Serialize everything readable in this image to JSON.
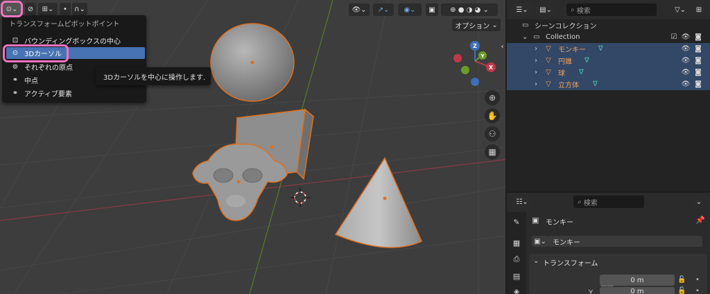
{
  "viewport": {
    "options_label": "オプション",
    "axis_labels": {
      "x": "X",
      "y": "Y",
      "z": "Z"
    }
  },
  "pivot_menu": {
    "title": "トランスフォームピボットポイント",
    "items": [
      {
        "label": "バウンディングボックスの中心",
        "icon": "bounding-box-icon"
      },
      {
        "label": "3Dカーソル",
        "icon": "cursor-icon",
        "active": true
      },
      {
        "label": "それぞれの原点",
        "icon": "individual-origins-icon"
      },
      {
        "label": "中点",
        "icon": "median-point-icon"
      },
      {
        "label": "アクティブ要素",
        "icon": "active-element-icon"
      }
    ],
    "tooltip": "3Dカーソルを中心に操作します."
  },
  "outliner": {
    "search_placeholder": "検索",
    "scene_collection": "シーンコレクション",
    "collection": "Collection",
    "objects": [
      "モンキー",
      "円錐",
      "球",
      "立方体"
    ]
  },
  "properties": {
    "search_placeholder": "検索",
    "object_name": "モンキー",
    "object_field": "モンキー",
    "section": "トランスフォーム",
    "location_label": "位置 X",
    "location_y_label": "Y",
    "location_x": "0 m",
    "location_y": "0 m"
  },
  "colors": {
    "accent": "#4772b3",
    "selection": "#f0a15a",
    "highlight": "#f173c0"
  }
}
